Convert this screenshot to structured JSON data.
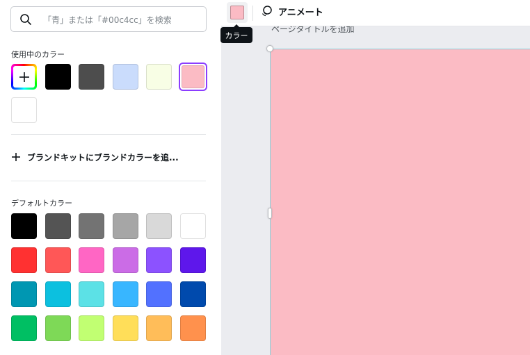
{
  "search": {
    "placeholder": "「青」または「#00c4cc」を検索"
  },
  "in_use": {
    "label": "使用中のカラー",
    "colors": [
      "#000000",
      "#4d4d4d",
      "#cadcfc",
      "#f8fee5",
      "#fbbbc4",
      "#ffffff"
    ],
    "selected_color": "#fbbbc4"
  },
  "brand": {
    "label": "ブランドキットにブランドカラーを追..."
  },
  "defaults": {
    "label": "デフォルトカラー",
    "rows": [
      [
        "#000000",
        "#545454",
        "#737373",
        "#a6a6a6",
        "#d9d9d9",
        "#ffffff"
      ],
      [
        "#ff3131",
        "#ff5757",
        "#ff66c4",
        "#cb6ce6",
        "#8c52ff",
        "#5e17eb"
      ],
      [
        "#0097b2",
        "#0cc0df",
        "#5ce1e6",
        "#38b6ff",
        "#5271ff",
        "#004aad"
      ],
      [
        "#00bf63",
        "#7ed957",
        "#c1ff72",
        "#ffde59",
        "#ffbd59",
        "#ff914d"
      ]
    ]
  },
  "toolbar": {
    "color_value": "#fbbbc4",
    "animate_label": "アニメート",
    "tooltip": "カラー"
  },
  "canvas": {
    "page_title": "ページタイトルを追加",
    "page_color": "#fbbbc4"
  }
}
